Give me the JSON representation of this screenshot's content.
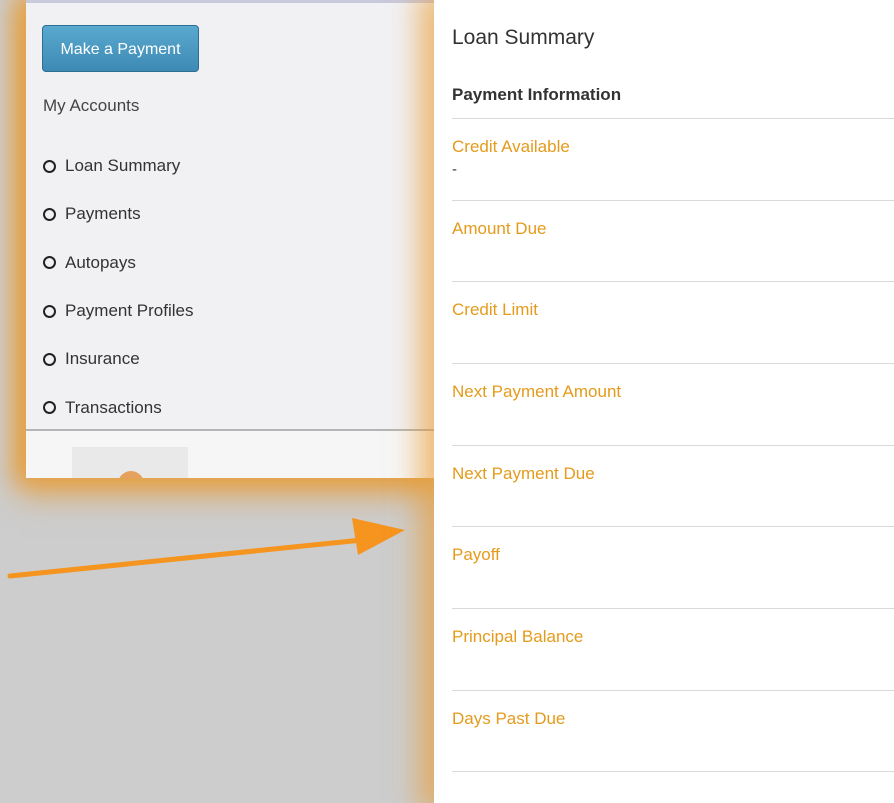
{
  "sidebar": {
    "make_payment_label": "Make a Payment",
    "accounts_title": "My Accounts",
    "items": [
      {
        "label": "Loan Summary"
      },
      {
        "label": "Payments"
      },
      {
        "label": "Autopays"
      },
      {
        "label": "Payment Profiles"
      },
      {
        "label": "Insurance"
      },
      {
        "label": "Transactions"
      }
    ]
  },
  "main": {
    "title": "Loan Summary",
    "section_title": "Payment Information",
    "rows": [
      {
        "label": "Credit Available",
        "value": "-"
      },
      {
        "label": "Amount Due",
        "value": ""
      },
      {
        "label": "Credit Limit",
        "value": ""
      },
      {
        "label": "Next Payment Amount",
        "value": ""
      },
      {
        "label": "Next Payment Due",
        "value": ""
      },
      {
        "label": "Payoff",
        "value": ""
      },
      {
        "label": "Principal Balance",
        "value": ""
      },
      {
        "label": "Days Past Due",
        "value": ""
      }
    ]
  },
  "colors": {
    "accent_orange": "#e49b1b",
    "button_blue": "#4a98c2",
    "arrow_orange": "#f5941f"
  },
  "icons": {
    "nav_marker": "ring-icon",
    "annotation": "arrow-icon"
  }
}
